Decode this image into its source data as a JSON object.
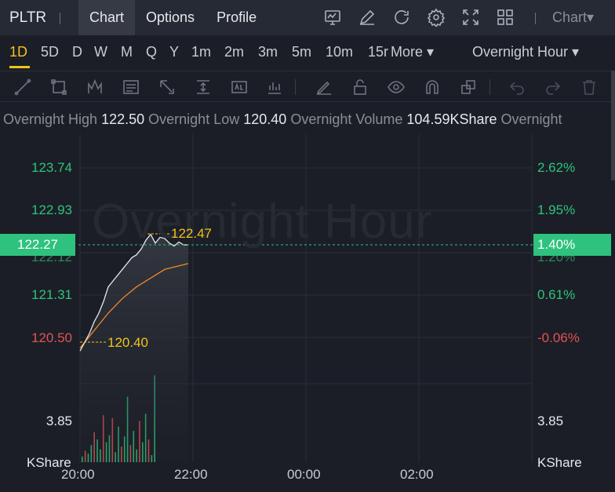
{
  "nav": {
    "ticker": "PLTR",
    "tabs": [
      {
        "label": "Chart",
        "active": true
      },
      {
        "label": "Options",
        "active": false
      },
      {
        "label": "Profile",
        "active": false
      }
    ],
    "icons": [
      "chart-monitor-icon",
      "edit-pencil-icon",
      "refresh-icon",
      "settings-gear-icon",
      "fullscreen-icon",
      "grid-layout-icon"
    ],
    "chart_menu": "Chart▾"
  },
  "timeframes": {
    "items": [
      "1D",
      "5D",
      "D",
      "W",
      "M",
      "Q",
      "Y",
      "1m",
      "2m",
      "3m",
      "5m",
      "10m",
      "15r",
      "More ▾"
    ],
    "active": "1D",
    "session": "Overnight Hour  ▾"
  },
  "toolbar": {
    "tools": [
      "trend-line-icon",
      "rectangle-icon",
      "pattern-icon",
      "text-note-icon",
      "arrow-icon",
      "measure-icon",
      "price-label-icon",
      "bar-stat-icon",
      "brush-icon",
      "lock-icon",
      "eye-icon",
      "magnet-icon",
      "layers-icon",
      "undo-icon",
      "redo-icon",
      "trash-icon"
    ]
  },
  "stats": {
    "overnight_high_label": "Overnight High",
    "overnight_high": "122.50",
    "overnight_low_label": "Overnight Low",
    "overnight_low": "120.40",
    "overnight_volume_label": "Overnight Volume",
    "overnight_volume": "104.59KShare",
    "trailing_label": "Overnight"
  },
  "chart": {
    "watermark": "Overnight Hour",
    "price_labels": [
      "123.74",
      "122.93",
      "121.31",
      "120.50"
    ],
    "pct_labels": [
      "2.62%",
      "1.95%",
      "0.61%",
      "-0.06%"
    ],
    "current_price": "122.27",
    "current_pct": "1.40%",
    "hidden_price": "122.12",
    "hidden_pct": "1.20%",
    "high_marker": "122.47",
    "low_marker": "120.40",
    "volume_left": "3.85",
    "volume_right": "3.85",
    "volume_unit_left": "KShare",
    "volume_unit_right": "KShare",
    "time_labels": [
      "20:00",
      "22:00",
      "00:00",
      "02:00"
    ],
    "colors": {
      "up": "#2ec27e",
      "down": "#e05353",
      "marker": "#f0c419",
      "price_line": "#e6e8ec",
      "avg_line": "#f08a24"
    }
  },
  "chart_data": {
    "type": "line",
    "series": [
      {
        "x": [
          "20:00",
          "20:05",
          "20:10",
          "20:15",
          "20:20",
          "20:25",
          "20:30",
          "20:35",
          "20:40",
          "20:45",
          "20:50",
          "20:55",
          "21:00",
          "21:05",
          "21:10",
          "21:15",
          "21:20",
          "21:25",
          "21:30",
          "21:35",
          "21:40",
          "21:45",
          "21:50",
          "21:55"
        ],
        "values": [
          120.45,
          120.6,
          120.75,
          120.95,
          121.1,
          121.3,
          121.55,
          121.65,
          121.75,
          121.85,
          121.95,
          122.05,
          122.1,
          122.2,
          122.35,
          122.45,
          122.3,
          122.4,
          122.38,
          122.3,
          122.25,
          122.32,
          122.27,
          122.27
        ]
      },
      {
        "x": [
          "20:00",
          "20:15",
          "20:30",
          "20:45",
          "21:00",
          "21:15",
          "21:30",
          "21:55"
        ],
        "values": [
          120.5,
          120.8,
          121.1,
          121.35,
          121.55,
          121.7,
          121.85,
          121.95
        ]
      }
    ],
    "ylim": [
      120.4,
      123.9
    ],
    "volume": [
      0.4,
      0.8,
      0.6,
      1.2,
      2.1,
      1.6,
      0.9,
      3.3,
      1.4,
      1.9,
      3.1,
      0.7,
      2.5,
      1.1,
      1.8,
      4.6,
      1.2,
      2.2,
      0.9,
      2.9,
      1.4,
      3.4,
      1.6,
      0.5,
      6.1
    ]
  }
}
